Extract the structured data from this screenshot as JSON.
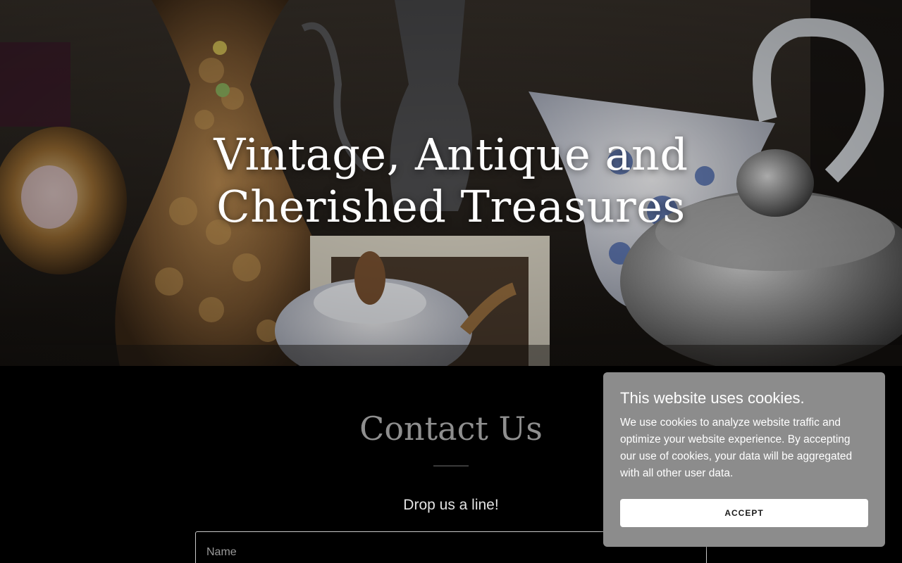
{
  "hero": {
    "title_line1": "Vintage, Antique and",
    "title_line2": "Cherished Treasures"
  },
  "contact": {
    "title": "Contact Us",
    "subtitle": "Drop us a line!",
    "name_placeholder": "Name"
  },
  "cookie_banner": {
    "title": "This website uses cookies.",
    "body": "We use cookies to analyze website traffic and optimize your website experience. By accepting our use of cookies, your data will be aggregated with all other user data.",
    "accept_label": "ACCEPT"
  },
  "colors": {
    "page_background": "#000000",
    "hero_title": "#ffffff",
    "contact_title": "#8f8f8f",
    "cookie_background": "#8c8c8c",
    "accept_button": "#ffffff"
  }
}
